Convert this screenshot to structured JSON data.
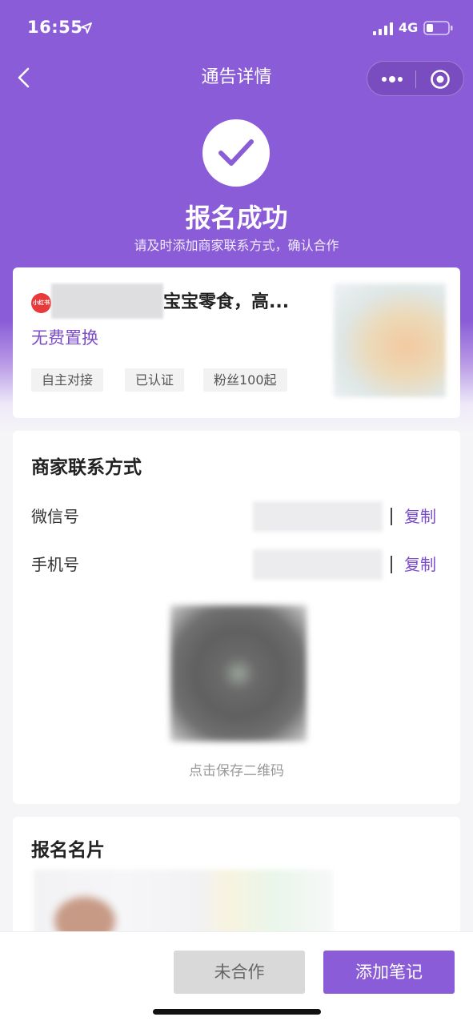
{
  "status_bar": {
    "time": "16:55",
    "network": "4G",
    "icons": [
      "location-arrow-icon",
      "signal-icon",
      "battery-icon"
    ]
  },
  "nav": {
    "title": "通告详情",
    "back_icon": "chevron-left-icon",
    "capsule_icons": [
      "more-dots-icon",
      "target-icon"
    ]
  },
  "success": {
    "icon": "check-icon",
    "title": "报名成功",
    "subtitle": "请及时添加商家联系方式，确认合作"
  },
  "notice": {
    "platform_logo_text": "小红书",
    "title": "宝宝零食，高...",
    "reward": "无费置换",
    "tags": [
      "自主对接",
      "已认证",
      "粉丝100起"
    ]
  },
  "contact": {
    "section_title": "商家联系方式",
    "rows": [
      {
        "label": "微信号",
        "action": "复制"
      },
      {
        "label": "手机号",
        "action": "复制"
      }
    ],
    "qr_hint": "点击保存二维码"
  },
  "namecard": {
    "section_title": "报名名片"
  },
  "actions": {
    "secondary": "未合作",
    "primary": "添加笔记"
  },
  "colors": {
    "accent": "#8a5cd8",
    "accent_text": "#7b4cc9",
    "platform_red": "#e83a3a"
  }
}
